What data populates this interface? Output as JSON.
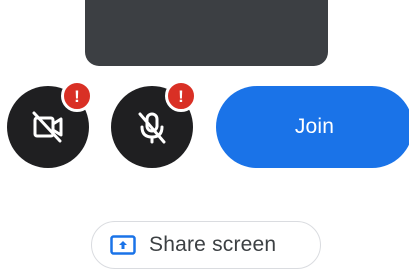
{
  "controls": {
    "camera": {
      "icon": "video-off-icon",
      "alert": "!"
    },
    "microphone": {
      "icon": "mic-off-icon",
      "alert": "!"
    },
    "join_label": "Join",
    "share_label": "Share screen",
    "share_icon": "present-to-all-icon"
  },
  "colors": {
    "preview_bg": "#3c3f43",
    "control_bg": "#1f1f21",
    "alert": "#d93025",
    "primary": "#1a73e8",
    "share_text": "#3c4043",
    "share_border": "#dadce0"
  }
}
